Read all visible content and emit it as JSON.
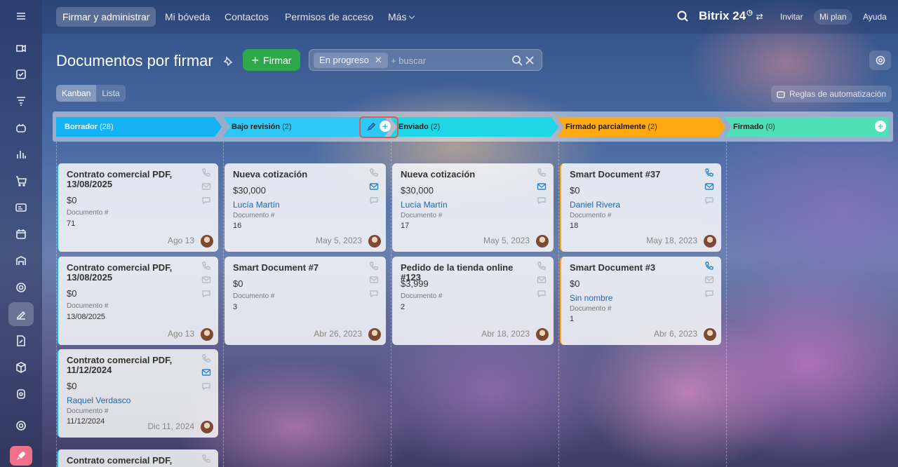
{
  "topnav": {
    "tabs": [
      "Firmar y administrar",
      "Mi bóveda",
      "Contactos",
      "Permisos de acceso",
      "Más"
    ],
    "brand": "Bitrix 24",
    "invite": "Invitar",
    "my_plan": "Mi plan",
    "help": "Ayuda"
  },
  "page": {
    "title": "Documentos por firmar",
    "sign_button": "Firmar",
    "filter_chip": "En progreso",
    "search_placeholder": "+ buscar",
    "views": [
      "Kanban",
      "Lista"
    ],
    "automation": "Reglas de automatización"
  },
  "stages": [
    {
      "name": "Borrador",
      "count": "(28)",
      "color": "#12b2f5"
    },
    {
      "name": "Bajo revisión",
      "count": "(2)",
      "color": "#2fc8f5"
    },
    {
      "name": "Enviado",
      "count": "(2)",
      "color": "#1fd6e6"
    },
    {
      "name": "Firmado parcialmente",
      "count": "(2)",
      "color": "#ffa80f"
    },
    {
      "name": "Firmado",
      "count": "(0)",
      "color": "#4fe0b8"
    }
  ],
  "cards": {
    "c0": {
      "title": "Contrato comercial PDF, 13/08/2025",
      "amount": "$0",
      "doc_label": "Documento #",
      "doc": "71",
      "date": "Ago 13"
    },
    "c1": {
      "title": "Contrato comercial PDF, 13/08/2025",
      "amount": "$0",
      "doc_label": "Documento #",
      "doc": "13/08/2025",
      "date": "Ago 13"
    },
    "c2": {
      "title": "Contrato comercial PDF, 11/12/2024",
      "amount": "$0",
      "contact": "Raquel Verdasco",
      "doc_label": "Documento #",
      "doc": "11/12/2024",
      "date": "Dic 11, 2024"
    },
    "c3": {
      "title": "Contrato comercial PDF,"
    },
    "r0": {
      "title": "Nueva cotización",
      "amount": "$30,000",
      "contact": "Lucía Martín",
      "doc_label": "Documento #",
      "doc": "16",
      "date": "May 5, 2023"
    },
    "r1": {
      "title": "Smart Document #7",
      "amount": "$0",
      "doc_label": "Documento #",
      "doc": "3",
      "date": "Abr 26, 2023"
    },
    "e0": {
      "title": "Nueva cotización",
      "amount": "$30,000",
      "contact": "Lucía Martín",
      "doc_label": "Documento #",
      "doc": "17",
      "date": "May 5, 2023"
    },
    "e1": {
      "title": "Pedido de la tienda online #123",
      "amount": "$3,999",
      "doc_label": "Documento #",
      "doc": "2",
      "date": "Abr 18, 2023"
    },
    "p0": {
      "title": "Smart Document #37",
      "amount": "$0",
      "contact": "Daniel Rivera",
      "doc_label": "Documento #",
      "doc": "18",
      "date": "May 18, 2023"
    },
    "p1": {
      "title": "Smart Document #3",
      "amount": "$0",
      "contact": "Sin nombre",
      "doc_label": "Documento #",
      "doc": "1",
      "date": "Abr 6, 2023"
    }
  }
}
